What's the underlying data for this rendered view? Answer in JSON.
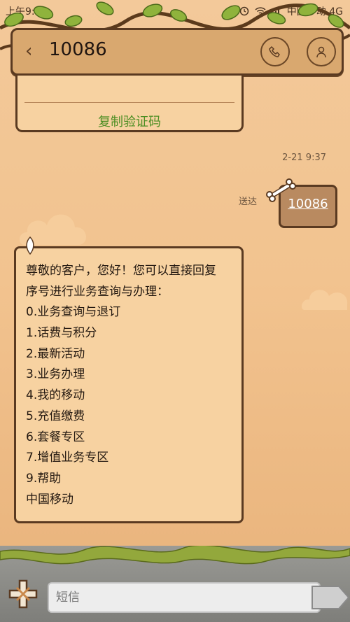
{
  "status_bar": {
    "time": "上午9:37",
    "carrier": "中国移动 4G",
    "icons": [
      "alarm-icon",
      "wifi-icon",
      "signal-icon"
    ]
  },
  "header": {
    "contact_number": "10086",
    "back_icon": "chevron-left-icon",
    "call_icon": "phone-icon",
    "contact_icon": "person-icon"
  },
  "prev_card": {
    "copy_code_label": "复制验证码"
  },
  "conversation": {
    "timestamp": "2-21 9:37",
    "sent": {
      "status": "送达",
      "text": "10086"
    },
    "received": {
      "lines": [
        "尊敬的客户，您好！您可以直接回复",
        "序号进行业务查询与办理：",
        "0.业务查询与退订",
        "1.话费与积分",
        "2.最新活动",
        "3.业务办理",
        "4.我的移动",
        "5.充值缴费",
        "6.套餐专区",
        "7.增值业务专区",
        "9.帮助",
        "中国移动"
      ]
    }
  },
  "composer": {
    "placeholder": "短信",
    "plus_icon": "plus-icon",
    "send_icon": "send-icon"
  },
  "colors": {
    "background": "#f2c38f",
    "board": "#d9a86f",
    "bubble": "#f7d2a1",
    "sent_bubble": "#b98a60",
    "border": "#5a3a21",
    "accent_green": "#4c8e23"
  }
}
